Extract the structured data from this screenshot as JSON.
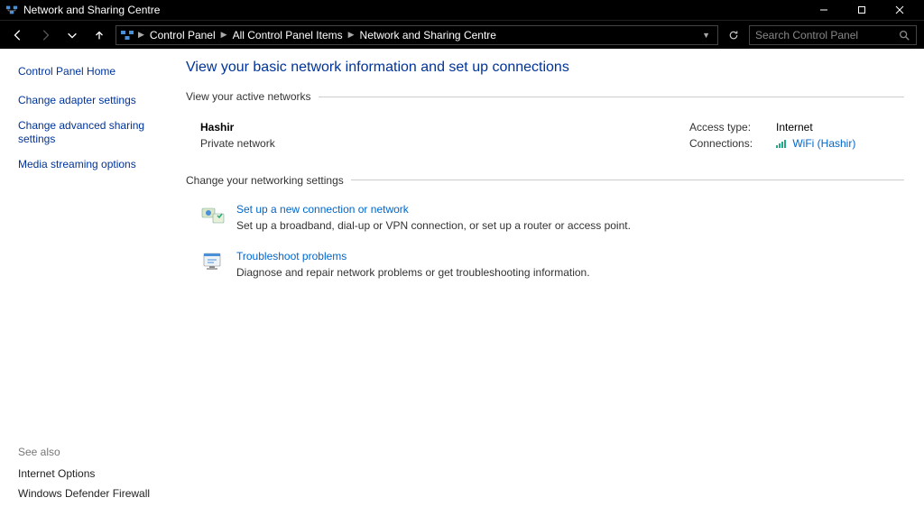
{
  "window": {
    "title": "Network and Sharing Centre"
  },
  "breadcrumb": [
    "Control Panel",
    "All Control Panel Items",
    "Network and Sharing Centre"
  ],
  "search": {
    "placeholder": "Search Control Panel"
  },
  "sidebar": {
    "home": "Control Panel Home",
    "links": [
      "Change adapter settings",
      "Change advanced sharing settings",
      "Media streaming options"
    ],
    "see_also_label": "See also",
    "see_also": [
      "Internet Options",
      "Windows Defender Firewall"
    ]
  },
  "main": {
    "heading": "View your basic network information and set up connections",
    "active_networks_label": "View your active networks",
    "network": {
      "name": "Hashir",
      "type": "Private network",
      "access_lbl": "Access type:",
      "access_val": "Internet",
      "conn_lbl": "Connections:",
      "conn_val": "WiFi (Hashir)"
    },
    "change_label": "Change your networking settings",
    "items": [
      {
        "title": "Set up a new connection or network",
        "desc": "Set up a broadband, dial-up or VPN connection, or set up a router or access point."
      },
      {
        "title": "Troubleshoot problems",
        "desc": "Diagnose and repair network problems or get troubleshooting information."
      }
    ]
  }
}
